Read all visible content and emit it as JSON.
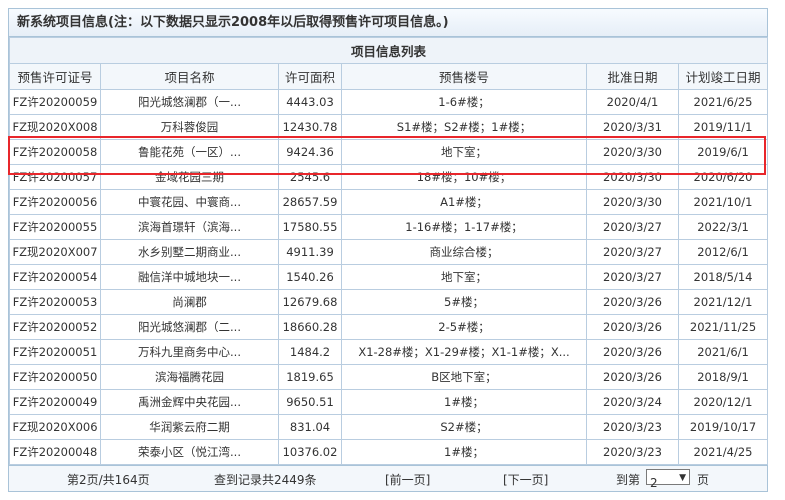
{
  "panel_title": "新系统项目信息(注：以下数据只显示2008年以后取得预售许可项目信息。)",
  "table_caption": "项目信息列表",
  "columns": [
    "预售许可证号",
    "项目名称",
    "许可面积",
    "预售楼号",
    "批准日期",
    "计划竣工日期"
  ],
  "rows": [
    {
      "permit": "FZ许20200059",
      "name": "阳光城悠澜郡（一...",
      "area": "4443.03",
      "buildings": "1-6#楼；",
      "approved": "2020/4/1",
      "completion": "2021/6/25"
    },
    {
      "permit": "FZ现2020X008",
      "name": "万科蓉俊园",
      "area": "12430.78",
      "buildings": "S1#楼；S2#楼；1#楼；",
      "approved": "2020/3/31",
      "completion": "2019/11/1"
    },
    {
      "permit": "FZ许20200058",
      "name": "鲁能花苑（一区）...",
      "area": "9424.36",
      "buildings": "地下室；",
      "approved": "2020/3/30",
      "completion": "2019/6/1"
    },
    {
      "permit": "FZ许20200057",
      "name": "金域花园三期",
      "area": "2545.6",
      "buildings": "18#楼；10#楼；",
      "approved": "2020/3/30",
      "completion": "2020/6/20"
    },
    {
      "permit": "FZ许20200056",
      "name": "中寰花园、中寰商...",
      "area": "28657.59",
      "buildings": "A1#楼；",
      "approved": "2020/3/30",
      "completion": "2021/10/1"
    },
    {
      "permit": "FZ许20200055",
      "name": "滨海首璟轩（滨海...",
      "area": "17580.55",
      "buildings": "1-16#楼；1-17#楼；",
      "approved": "2020/3/27",
      "completion": "2022/3/1"
    },
    {
      "permit": "FZ现2020X007",
      "name": "水乡别墅二期商业...",
      "area": "4911.39",
      "buildings": "商业综合楼；",
      "approved": "2020/3/27",
      "completion": "2012/6/1"
    },
    {
      "permit": "FZ许20200054",
      "name": "融信洋中城地块一...",
      "area": "1540.26",
      "buildings": "地下室；",
      "approved": "2020/3/27",
      "completion": "2018/5/14"
    },
    {
      "permit": "FZ许20200053",
      "name": "尚澜郡",
      "area": "12679.68",
      "buildings": "5#楼；",
      "approved": "2020/3/26",
      "completion": "2021/12/1"
    },
    {
      "permit": "FZ许20200052",
      "name": "阳光城悠澜郡（二...",
      "area": "18660.28",
      "buildings": "2-5#楼；",
      "approved": "2020/3/26",
      "completion": "2021/11/25"
    },
    {
      "permit": "FZ许20200051",
      "name": "万科九里商务中心...",
      "area": "1484.2",
      "buildings": "X1-28#楼；X1-29#楼；X1-1#楼；X...",
      "approved": "2020/3/26",
      "completion": "2021/6/1"
    },
    {
      "permit": "FZ许20200050",
      "name": "滨海福腾花园",
      "area": "1819.65",
      "buildings": "B区地下室；",
      "approved": "2020/3/26",
      "completion": "2018/9/1"
    },
    {
      "permit": "FZ许20200049",
      "name": "禹洲金辉中央花园...",
      "area": "9650.51",
      "buildings": "1#楼；",
      "approved": "2020/3/24",
      "completion": "2020/12/1"
    },
    {
      "permit": "FZ现2020X006",
      "name": "华润紫云府二期",
      "area": "831.04",
      "buildings": "S2#楼；",
      "approved": "2020/3/23",
      "completion": "2019/10/17"
    },
    {
      "permit": "FZ许20200048",
      "name": "荣泰小区（悦江湾...",
      "area": "10376.02",
      "buildings": "1#楼；",
      "approved": "2020/3/23",
      "completion": "2021/4/25"
    }
  ],
  "footer": {
    "page_info": "第2页/共164页",
    "record_info": "查到记录共2449条",
    "prev": "[前一页]",
    "next": "[下一页]",
    "goto_label": "到第",
    "page_value": "2",
    "page_suffix": "页"
  }
}
